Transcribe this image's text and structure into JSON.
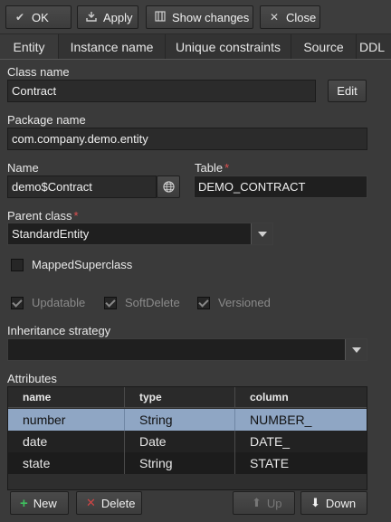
{
  "toolbar": {
    "ok": "OK",
    "apply": "Apply",
    "show_changes": "Show changes",
    "close": "Close"
  },
  "tabs": [
    "Entity",
    "Instance name",
    "Unique constraints",
    "Source",
    "DDL"
  ],
  "form": {
    "class_name_label": "Class name",
    "class_name_value": "Contract",
    "edit_label": "Edit",
    "package_name_label": "Package name",
    "package_name_value": "com.company.demo.entity",
    "name_label": "Name",
    "name_value": "demo$Contract",
    "table_label": "Table",
    "table_value": "DEMO_CONTRACT",
    "parent_class_label": "Parent class",
    "parent_class_value": "StandardEntity",
    "mapped_superclass_label": "MappedSuperclass",
    "updatable_label": "Updatable",
    "soft_delete_label": "SoftDelete",
    "versioned_label": "Versioned",
    "inheritance_label": "Inheritance strategy",
    "inheritance_value": "",
    "required_mark": "*"
  },
  "checks": {
    "mapped_superclass": false,
    "updatable": true,
    "soft_delete": true,
    "versioned": true
  },
  "attributes": {
    "label": "Attributes",
    "columns": [
      "name",
      "type",
      "column"
    ],
    "rows": [
      {
        "name": "number",
        "type": "String",
        "column": "NUMBER_"
      },
      {
        "name": "date",
        "type": "Date",
        "column": "DATE_"
      },
      {
        "name": "state",
        "type": "String",
        "column": "STATE"
      }
    ],
    "selected_row": 0
  },
  "bottom": {
    "new": "New",
    "delete": "Delete",
    "up": "Up",
    "down": "Down"
  },
  "colors": {
    "accent_green": "#3fbf5f",
    "accent_red": "#d04545",
    "selection": "#8fa6c4"
  }
}
